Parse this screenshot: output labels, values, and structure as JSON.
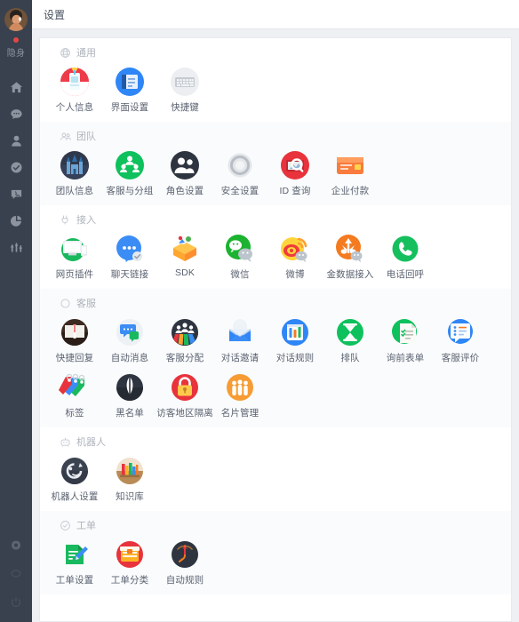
{
  "sidebar": {
    "avatar_name": "user-avatar",
    "status_dot_color": "#e64545",
    "status_label": "隐身",
    "nav_items": [
      {
        "icon": "home-icon",
        "name": "sidebar-item-home"
      },
      {
        "icon": "chat-bubble-icon",
        "name": "sidebar-item-chat"
      },
      {
        "icon": "person-icon",
        "name": "sidebar-item-contacts"
      },
      {
        "icon": "check-circle-icon",
        "name": "sidebar-item-tasks"
      },
      {
        "icon": "message-ticket-icon",
        "name": "sidebar-item-tickets"
      },
      {
        "icon": "pie-chart-icon",
        "name": "sidebar-item-statistics"
      },
      {
        "icon": "sliders-icon",
        "name": "sidebar-item-tools"
      }
    ],
    "bottom_items": [
      {
        "icon": "gear-icon",
        "name": "sidebar-item-settings"
      },
      {
        "icon": "speech-oval-icon",
        "name": "sidebar-item-feedback"
      },
      {
        "icon": "power-icon",
        "name": "sidebar-item-logout"
      }
    ]
  },
  "header": {
    "title": "设置"
  },
  "sections": [
    {
      "id": "general",
      "title": "通用",
      "icon": "globe-icon",
      "shaded": false,
      "items": [
        {
          "label": "个人信息",
          "icon": "badge-icon"
        },
        {
          "label": "界面设置",
          "icon": "interface-book-icon"
        },
        {
          "label": "快捷键",
          "icon": "keyboard-icon"
        }
      ]
    },
    {
      "id": "team",
      "title": "团队",
      "icon": "team-people-icon",
      "shaded": true,
      "items": [
        {
          "label": "团队信息",
          "icon": "castle-icon"
        },
        {
          "label": "客服与分组",
          "icon": "green-group-icon"
        },
        {
          "label": "角色设置",
          "icon": "dark-people-icon"
        },
        {
          "label": "安全设置",
          "icon": "gray-shield-ring-icon"
        },
        {
          "label": "ID 查询",
          "icon": "red-search-icon"
        },
        {
          "label": "企业付款",
          "icon": "orange-card-icon"
        }
      ]
    },
    {
      "id": "access",
      "title": "接入",
      "icon": "plug-icon",
      "shaded": false,
      "items": [
        {
          "label": "网页插件",
          "icon": "monitor-green-icon"
        },
        {
          "label": "聊天链接",
          "icon": "blue-chat-icon"
        },
        {
          "label": "SDK",
          "icon": "sdk-box-icon"
        },
        {
          "label": "微信",
          "icon": "wechat-icon"
        },
        {
          "label": "微博",
          "icon": "weibo-icon"
        },
        {
          "label": "金数据接入",
          "icon": "jinshuju-icon"
        },
        {
          "label": "电话回呼",
          "icon": "phone-green-icon"
        }
      ]
    },
    {
      "id": "service",
      "title": "客服",
      "icon": "circle-outline-icon",
      "shaded": true,
      "items": [
        {
          "label": "快捷回复",
          "icon": "book-icon"
        },
        {
          "label": "自动消息",
          "icon": "auto-message-icon"
        },
        {
          "label": "客服分配",
          "icon": "assign-rainbow-icon"
        },
        {
          "label": "对话邀请",
          "icon": "envelope-icon"
        },
        {
          "label": "对话规则",
          "icon": "rules-blue-icon"
        },
        {
          "label": "排队",
          "icon": "hourglass-icon"
        },
        {
          "label": "询前表单",
          "icon": "form-green-icon"
        },
        {
          "label": "客服评价",
          "icon": "rating-blue-icon"
        },
        {
          "label": "标签",
          "icon": "tags-icon"
        },
        {
          "label": "黑名单",
          "icon": "blacklist-icon"
        },
        {
          "label": "访客地区隔离",
          "icon": "lock-red-icon"
        },
        {
          "label": "名片管理",
          "icon": "card-orange-icon"
        }
      ]
    },
    {
      "id": "robot",
      "title": "机器人",
      "icon": "robot-head-icon",
      "shaded": false,
      "items": [
        {
          "label": "机器人设置",
          "icon": "robot-dark-icon"
        },
        {
          "label": "知识库",
          "icon": "books-icon"
        }
      ]
    },
    {
      "id": "ticket",
      "title": "工单",
      "icon": "check-outline-icon",
      "shaded": true,
      "items": [
        {
          "label": "工单设置",
          "icon": "ticket-green-icon"
        },
        {
          "label": "工单分类",
          "icon": "ticket-red-icon"
        },
        {
          "label": "自动规则",
          "icon": "auto-rule-icon"
        }
      ]
    }
  ]
}
